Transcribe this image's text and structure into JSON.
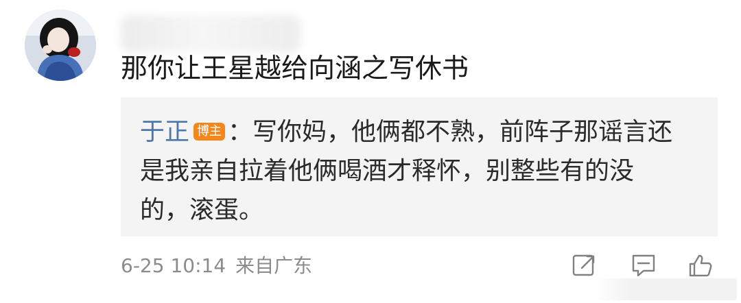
{
  "comment": {
    "username_visible": "",
    "text": "那你让王星越给向涵之写休书"
  },
  "reply": {
    "author": "于正",
    "badge": "博主",
    "separator": "：",
    "text": "写你妈，他俩都不熟，前阵子那谣言还是我亲自拉着他俩喝酒才释怀，别整些有的没的，滚蛋。"
  },
  "meta": {
    "date": "6-25 10:14",
    "source": "来自广东"
  },
  "icons": {
    "share": "share-edit-icon",
    "comment": "comment-icon",
    "like": "thumbs-up-icon"
  },
  "colors": {
    "author_link": "#4a78a8",
    "badge_bg": "#f2881c",
    "reply_bg": "#f4f4f4",
    "meta_text": "#8b8b8b"
  }
}
